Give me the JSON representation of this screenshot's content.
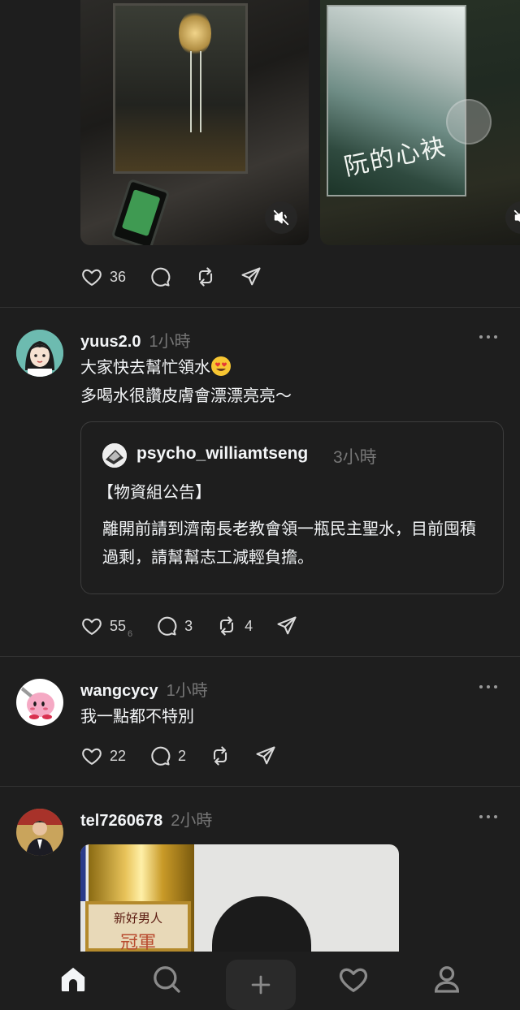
{
  "feed": {
    "first_post": {
      "like_count": "36",
      "media": [
        {
          "name": "video-tile-1",
          "mute_icon": "speaker-muted-icon"
        },
        {
          "name": "video-tile-2",
          "screen_text": "阮的心袂",
          "mute_icon": "speaker-muted-icon"
        }
      ]
    },
    "posts": [
      {
        "username": "yuus2.0",
        "time": "1小時",
        "text_line1": "大家快去幫忙領水",
        "text_line2": "多喝水很讚皮膚會漂漂亮亮～",
        "quote": {
          "username": "psycho_williamtseng",
          "time": "3小時",
          "title": "【物資組公告】",
          "body": "離開前請到濟南長老教會領一瓶民主聖水，目前囤積過剩，請幫幫志工減輕負擔。"
        },
        "like_count": "55",
        "like_sub": "6",
        "reply_count": "3",
        "repost_count": "4"
      },
      {
        "username": "wangcycy",
        "time": "1小時",
        "text": "我一點都不特別",
        "like_count": "22",
        "reply_count": "2"
      },
      {
        "username": "tel7260678",
        "time": "2小時",
        "image": {
          "plaque_line1": "新好男人",
          "plaque_line2": "冠軍"
        }
      }
    ]
  },
  "tabbar": {
    "items": [
      "home-icon",
      "search-icon",
      "plus-icon",
      "heart-icon",
      "profile-icon"
    ],
    "active": "home-icon"
  },
  "colors": {
    "background": "#1e1e1e",
    "text": "#f3f5f7",
    "muted": "#777777",
    "divider": "#333333"
  }
}
